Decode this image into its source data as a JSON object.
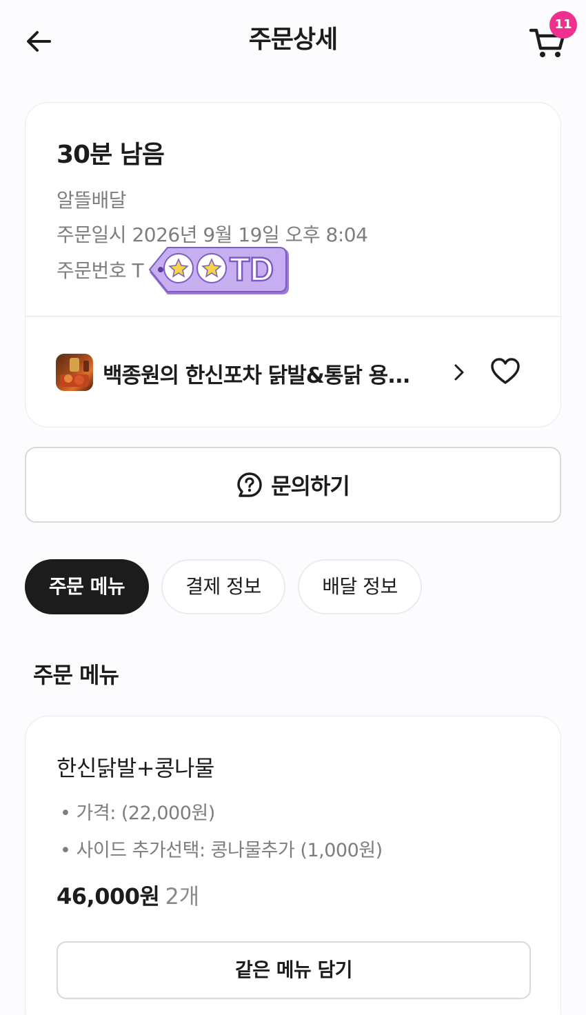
{
  "header": {
    "title": "주문상세",
    "cart_badge": "11",
    "back_icon": "arrow-left-icon",
    "cart_icon": "cart-icon"
  },
  "order": {
    "remaining": "30분 남음",
    "delivery_type": "알뜰배달",
    "order_datetime": "주문일시 2026년 9월 19일 오후 8:04",
    "order_number": "주문번호 T",
    "sticker_text": "TD",
    "store_name": "백종원의 한신포차 닭발&통닭 용...",
    "store_chevron_icon": "chevron-right-icon",
    "favorite_icon": "heart-outline-icon"
  },
  "inquiry": {
    "label": "문의하기",
    "icon": "question-chat-icon"
  },
  "tabs": [
    {
      "label": "주문 메뉴",
      "active": true
    },
    {
      "label": "결제 정보",
      "active": false
    },
    {
      "label": "배달 정보",
      "active": false
    }
  ],
  "section": {
    "title": "주문 메뉴"
  },
  "menu_item": {
    "name": "한신닭발+콩나물",
    "options": [
      "• 가격:  (22,000원)",
      "• 사이드 추가선택: 콩나물추가 (1,000원)"
    ],
    "price": "46,000원",
    "quantity": "2개",
    "add_same_label": "같은 메뉴 담기"
  },
  "colors": {
    "accent_badge": "#f0308f",
    "active_tab": "#1c1c1c",
    "sticker_purple": "#b99be6"
  }
}
